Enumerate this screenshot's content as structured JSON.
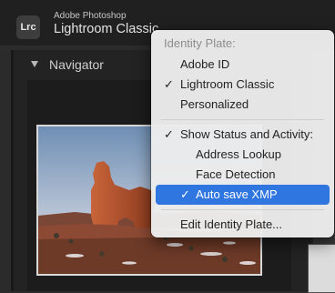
{
  "app": {
    "logo_text": "Lrc",
    "vendor": "Adobe Photoshop",
    "name": "Lightroom Classic"
  },
  "panel": {
    "title": "Navigator"
  },
  "menu": {
    "items": [
      {
        "label": "Identity Plate:",
        "check": ""
      },
      {
        "label": "Adobe ID",
        "check": ""
      },
      {
        "label": "Lightroom Classic",
        "check": "✓"
      },
      {
        "label": "Personalized",
        "check": ""
      },
      {
        "label": "Show Status and Activity:",
        "check": "✓"
      },
      {
        "label": "Address Lookup",
        "check": ""
      },
      {
        "label": "Face Detection",
        "check": ""
      },
      {
        "label": "Auto save XMP",
        "check": "✓"
      },
      {
        "label": "Edit Identity Plate...",
        "check": ""
      }
    ]
  },
  "colors": {
    "selection": "#2f76e0",
    "menu_background": "#ececec"
  }
}
